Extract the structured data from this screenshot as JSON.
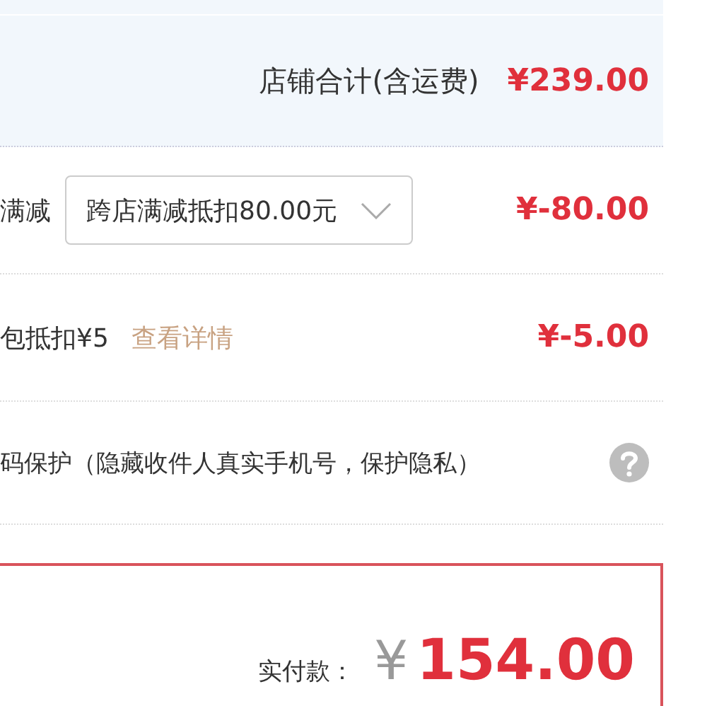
{
  "shop_total": {
    "label": "店铺合计(含运费)",
    "amount": "¥239.00"
  },
  "discounts": [
    {
      "kind": "select",
      "label": "满减",
      "value": "跨店满减抵扣80.00元",
      "amount": "¥-80.00"
    },
    {
      "kind": "link",
      "label": "包抵扣¥5",
      "link": "查看详情",
      "amount": "¥-5.00"
    }
  ],
  "privacy": {
    "label": "码保护（隐藏收件人真实手机号，保护隐私）"
  },
  "payment": {
    "label": "实付款：",
    "currency": "¥",
    "amount": "154.00"
  }
}
